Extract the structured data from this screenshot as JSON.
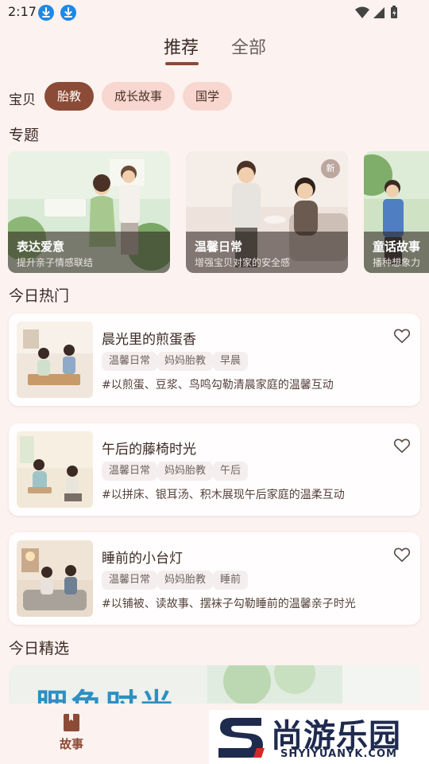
{
  "status_bar": {
    "time": "2:17"
  },
  "tabs": [
    {
      "label": "推荐",
      "active": true
    },
    {
      "label": "全部",
      "active": false
    }
  ],
  "filter": {
    "label": "宝贝",
    "chips": [
      {
        "label": "胎教",
        "active": true
      },
      {
        "label": "成长故事",
        "active": false
      },
      {
        "label": "国学",
        "active": false
      }
    ]
  },
  "topics": {
    "section_title": "专题",
    "cards": [
      {
        "title": "表达爱意",
        "subtitle": "提升亲子情感联结"
      },
      {
        "title": "温馨日常",
        "subtitle": "增强宝贝对家的安全感",
        "badge": "新"
      },
      {
        "title": "童话故事",
        "subtitle": "播种想象力"
      }
    ]
  },
  "hot": {
    "section_title": "今日热门",
    "items": [
      {
        "title": "晨光里的煎蛋香",
        "tags": [
          "温馨日常",
          "妈妈胎教",
          "早晨"
        ],
        "description": "#以煎蛋、豆浆、鸟鸣勾勒清晨家庭的温馨互动"
      },
      {
        "title": "午后的藤椅时光",
        "tags": [
          "温馨日常",
          "妈妈胎教",
          "午后"
        ],
        "description": "#以拼床、银耳汤、积木展现午后家庭的温柔互动"
      },
      {
        "title": "睡前的小台灯",
        "tags": [
          "温馨日常",
          "妈妈胎教",
          "睡前"
        ],
        "description": "#以铺被、读故事、摆袜子勾勒睡前的温馨亲子时光"
      }
    ]
  },
  "featured": {
    "section_title": "今日精选",
    "banner_text": "胭鱼时光"
  },
  "bottom_nav": {
    "items": [
      {
        "label": "故事",
        "active": true,
        "icon": "book-icon"
      }
    ]
  },
  "watermark": {
    "text": "尚游乐园",
    "subtext": "SHYIYUANYK.COM"
  },
  "colors": {
    "accent": "#8b4b37",
    "chip_inactive": "#f7d7cf",
    "background": "#fcf2ef",
    "card": "#fffdfd"
  }
}
